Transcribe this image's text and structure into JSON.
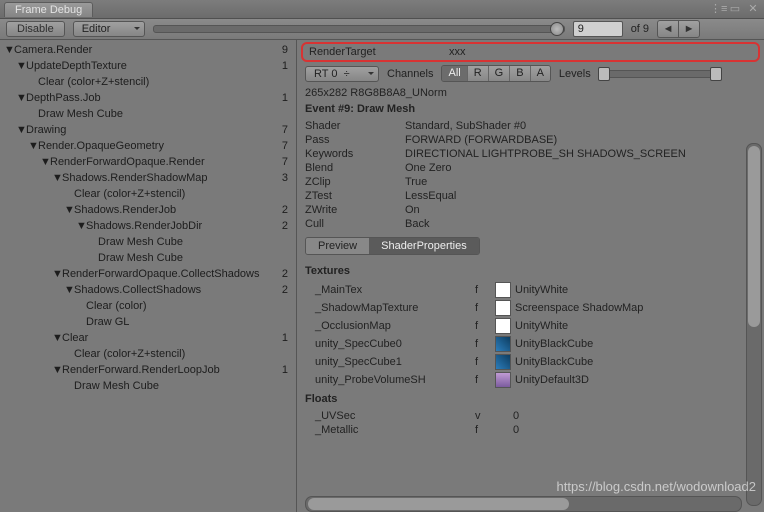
{
  "window": {
    "title": "Frame Debug"
  },
  "toolbar": {
    "disable_label": "Disable",
    "target_label": "Editor",
    "frame": "9",
    "total": "of 9"
  },
  "tree": [
    {
      "indent": 0,
      "tri": "▼",
      "label": "Camera.Render",
      "num": "9"
    },
    {
      "indent": 1,
      "tri": "▼",
      "label": "UpdateDepthTexture",
      "num": "1"
    },
    {
      "indent": 2,
      "tri": "",
      "label": "Clear (color+Z+stencil)",
      "num": ""
    },
    {
      "indent": 1,
      "tri": "▼",
      "label": "DepthPass.Job",
      "num": "1"
    },
    {
      "indent": 2,
      "tri": "",
      "label": "Draw Mesh Cube",
      "num": ""
    },
    {
      "indent": 1,
      "tri": "▼",
      "label": "Drawing",
      "num": "7"
    },
    {
      "indent": 2,
      "tri": "▼",
      "label": "Render.OpaqueGeometry",
      "num": "7"
    },
    {
      "indent": 3,
      "tri": "▼",
      "label": "RenderForwardOpaque.Render",
      "num": "7"
    },
    {
      "indent": 4,
      "tri": "▼",
      "label": "Shadows.RenderShadowMap",
      "num": "3"
    },
    {
      "indent": 5,
      "tri": "",
      "label": "Clear (color+Z+stencil)",
      "num": ""
    },
    {
      "indent": 5,
      "tri": "▼",
      "label": "Shadows.RenderJob",
      "num": "2"
    },
    {
      "indent": 6,
      "tri": "▼",
      "label": "Shadows.RenderJobDir",
      "num": "2"
    },
    {
      "indent": 7,
      "tri": "",
      "label": "Draw Mesh Cube",
      "num": ""
    },
    {
      "indent": 7,
      "tri": "",
      "label": "Draw Mesh Cube",
      "num": ""
    },
    {
      "indent": 4,
      "tri": "▼",
      "label": "RenderForwardOpaque.CollectShadows",
      "num": "2"
    },
    {
      "indent": 5,
      "tri": "▼",
      "label": "Shadows.CollectShadows",
      "num": "2"
    },
    {
      "indent": 6,
      "tri": "",
      "label": "Clear (color)",
      "num": ""
    },
    {
      "indent": 6,
      "tri": "",
      "label": "Draw GL",
      "num": ""
    },
    {
      "indent": 4,
      "tri": "▼",
      "label": "Clear",
      "num": "1"
    },
    {
      "indent": 5,
      "tri": "",
      "label": "Clear (color+Z+stencil)",
      "num": ""
    },
    {
      "indent": 4,
      "tri": "▼",
      "label": "RenderForward.RenderLoopJob",
      "num": "1"
    },
    {
      "indent": 5,
      "tri": "",
      "label": "Draw Mesh Cube",
      "num": ""
    }
  ],
  "inspector": {
    "highlight": {
      "num": "9",
      "label": "RenderTarget",
      "value": "xxx"
    },
    "rt_label": "RT 0",
    "channels_label": "Channels",
    "channels": [
      "All",
      "R",
      "G",
      "B",
      "A"
    ],
    "channels_selected": "All",
    "levels_label": "Levels",
    "dims": "265x282 R8G8B8A8_UNorm",
    "event_title": "Event #9: Draw Mesh",
    "props": [
      {
        "k": "Shader",
        "v": "Standard, SubShader #0"
      },
      {
        "k": "Pass",
        "v": "FORWARD (FORWARDBASE)"
      },
      {
        "k": "Keywords",
        "v": "DIRECTIONAL LIGHTPROBE_SH SHADOWS_SCREEN"
      },
      {
        "k": "Blend",
        "v": "One Zero"
      },
      {
        "k": "ZClip",
        "v": "True"
      },
      {
        "k": "ZTest",
        "v": "LessEqual"
      },
      {
        "k": "ZWrite",
        "v": "On"
      },
      {
        "k": "Cull",
        "v": "Back"
      }
    ],
    "tabs": {
      "preview": "Preview",
      "shaderprops": "ShaderProperties",
      "selected": "ShaderProperties"
    },
    "textures_header": "Textures",
    "textures": [
      {
        "name": "_MainTex",
        "type": "f",
        "icon": "white",
        "val": "UnityWhite"
      },
      {
        "name": "_ShadowMapTexture",
        "type": "f",
        "icon": "white",
        "val": "Screenspace ShadowMap"
      },
      {
        "name": "_OcclusionMap",
        "type": "f",
        "icon": "white",
        "val": "UnityWhite"
      },
      {
        "name": "unity_SpecCube0",
        "type": "f",
        "icon": "cube",
        "val": "UnityBlackCube"
      },
      {
        "name": "unity_SpecCube1",
        "type": "f",
        "icon": "cube",
        "val": "UnityBlackCube"
      },
      {
        "name": "unity_ProbeVolumeSH",
        "type": "f",
        "icon": "vol",
        "val": "UnityDefault3D"
      }
    ],
    "floats_header": "Floats",
    "floats": [
      {
        "name": "_UVSec",
        "type": "v",
        "val": "0"
      },
      {
        "name": "_Metallic",
        "type": "f",
        "val": "0"
      }
    ]
  },
  "watermark": "https://blog.csdn.net/wodownload2"
}
